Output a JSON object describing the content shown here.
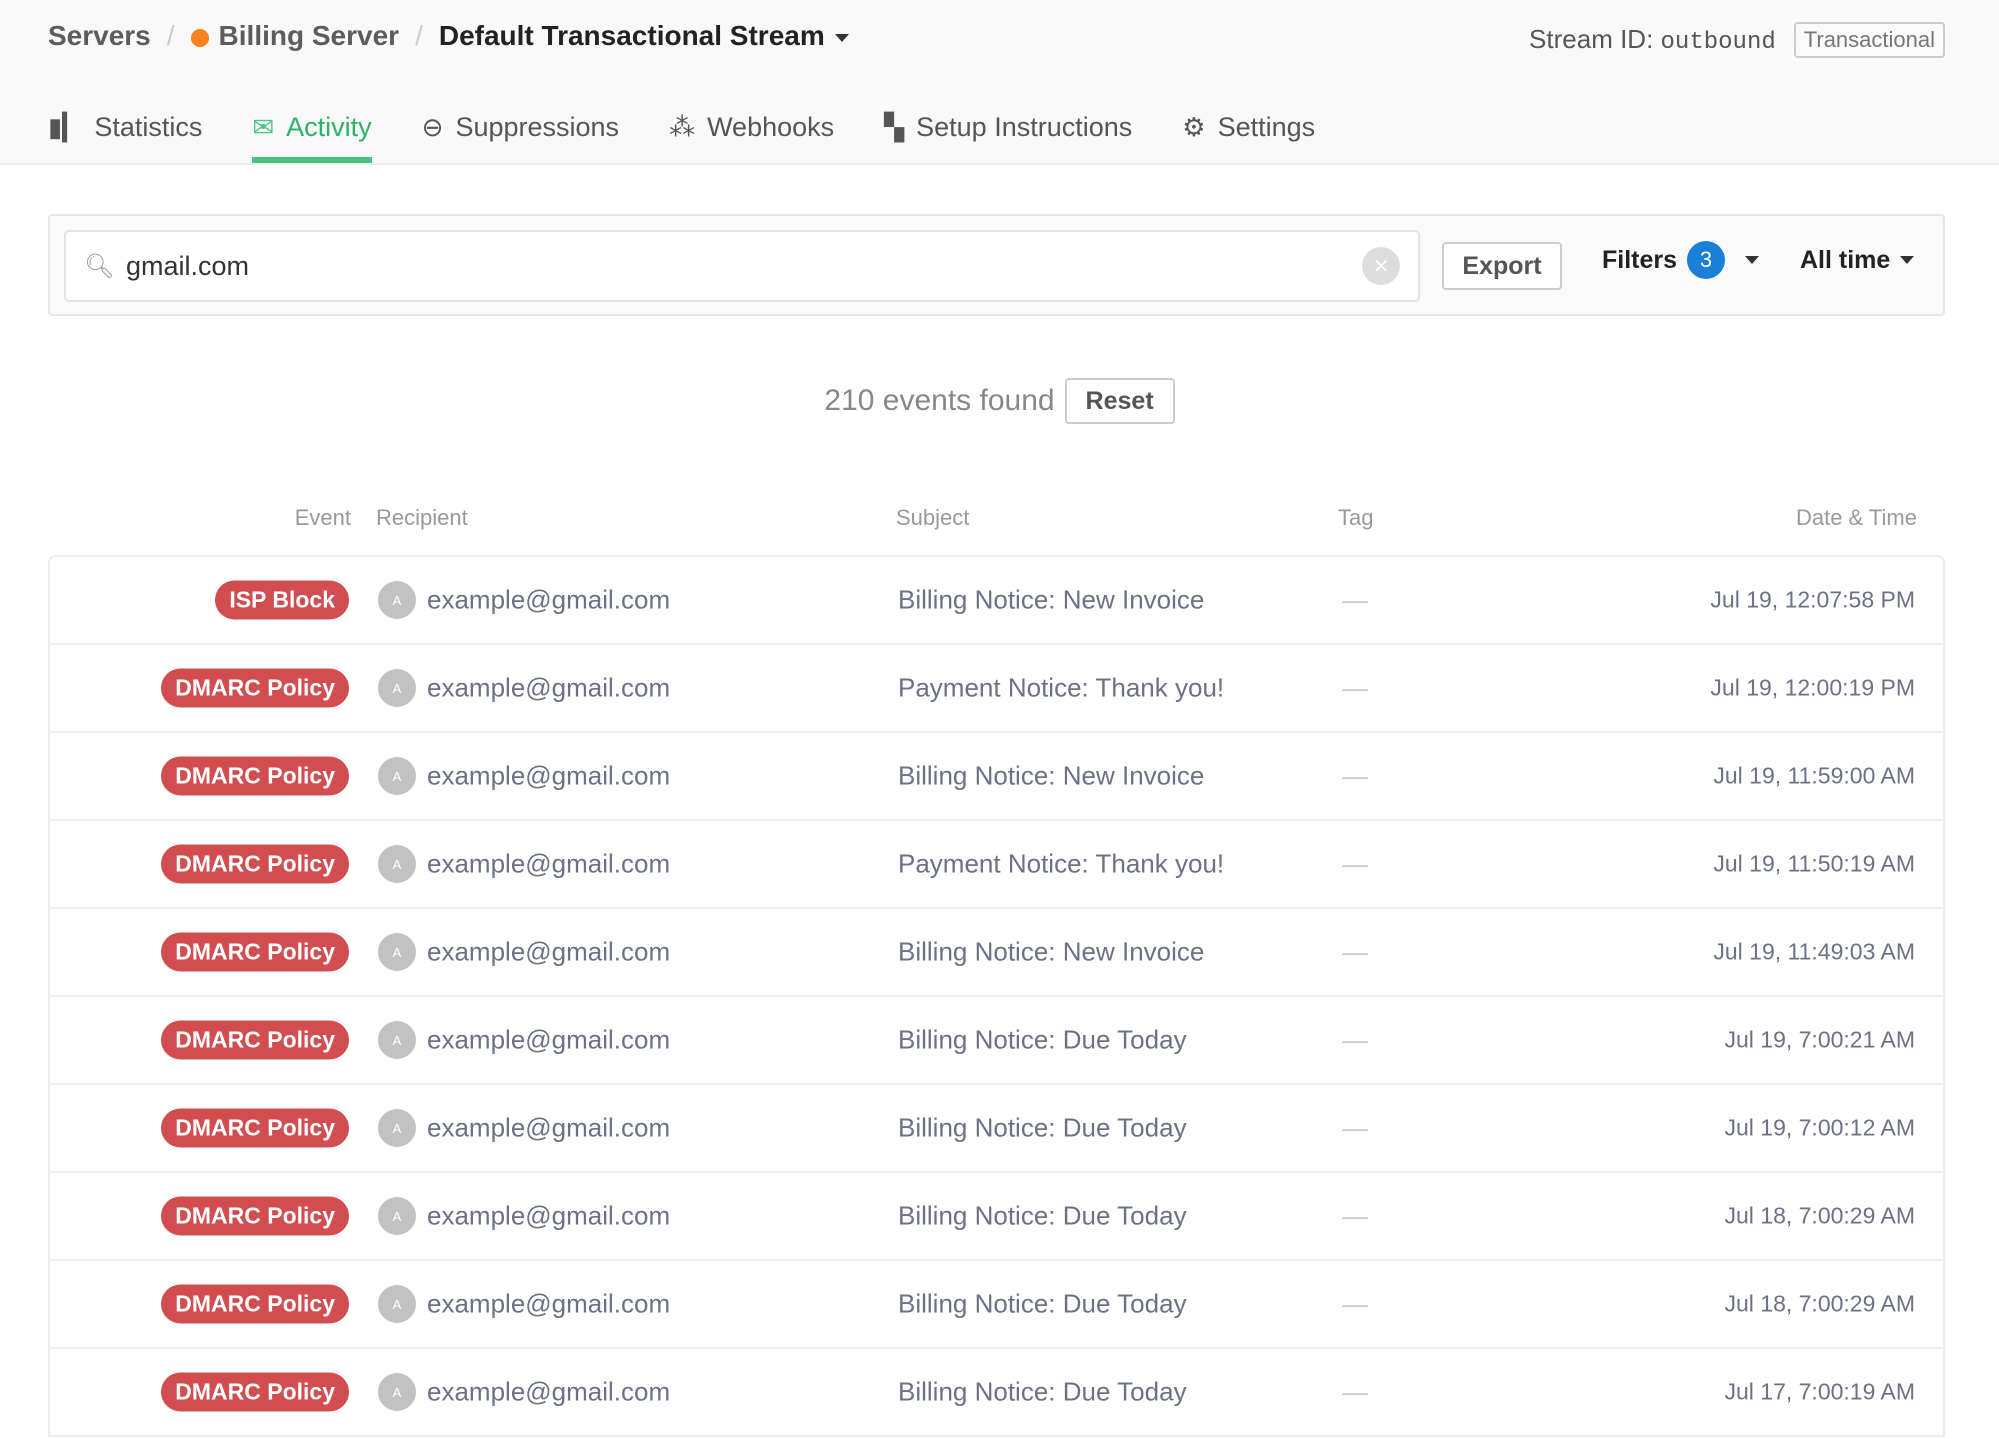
{
  "breadcrumb": {
    "servers": "Servers",
    "server": "Billing Server",
    "stream": "Default Transactional Stream",
    "server_color": "#f7831f"
  },
  "stream_id": {
    "label": "Stream ID:",
    "value": "outbound",
    "type": "Transactional"
  },
  "tabs": [
    {
      "label": "Statistics",
      "icon": "bar-chart-icon"
    },
    {
      "label": "Activity",
      "icon": "envelope-icon"
    },
    {
      "label": "Suppressions",
      "icon": "minus-circle-icon"
    },
    {
      "label": "Webhooks",
      "icon": "webhook-icon"
    },
    {
      "label": "Setup Instructions",
      "icon": "map-icon"
    },
    {
      "label": "Settings",
      "icon": "gear-icon"
    }
  ],
  "search": {
    "value": "gmail.com"
  },
  "toolbar": {
    "export": "Export",
    "filters": "Filters",
    "filter_count": "3",
    "time": "All time"
  },
  "results": {
    "found": "210 events found",
    "reset": "Reset"
  },
  "columns": {
    "event": "Event",
    "recipient": "Recipient",
    "subject": "Subject",
    "tag": "Tag",
    "date": "Date & Time"
  },
  "rows": [
    {
      "event": "ISP Block",
      "avatar": "A",
      "recipient": "example@gmail.com",
      "subject": "Billing Notice: New Invoice",
      "tag": "—",
      "date": "Jul 19, 12:07:58 PM"
    },
    {
      "event": "DMARC Policy",
      "avatar": "A",
      "recipient": "example@gmail.com",
      "subject": "Payment Notice: Thank you!",
      "tag": "—",
      "date": "Jul 19, 12:00:19 PM"
    },
    {
      "event": "DMARC Policy",
      "avatar": "A",
      "recipient": "example@gmail.com",
      "subject": "Billing Notice: New Invoice",
      "tag": "—",
      "date": "Jul 19, 11:59:00 AM"
    },
    {
      "event": "DMARC Policy",
      "avatar": "A",
      "recipient": "example@gmail.com",
      "subject": "Payment Notice: Thank you!",
      "tag": "—",
      "date": "Jul 19, 11:50:19 AM"
    },
    {
      "event": "DMARC Policy",
      "avatar": "A",
      "recipient": "example@gmail.com",
      "subject": "Billing Notice: New Invoice",
      "tag": "—",
      "date": "Jul 19, 11:49:03 AM"
    },
    {
      "event": "DMARC Policy",
      "avatar": "A",
      "recipient": "example@gmail.com",
      "subject": "Billing Notice: Due Today",
      "tag": "—",
      "date": "Jul 19, 7:00:21 AM"
    },
    {
      "event": "DMARC Policy",
      "avatar": "A",
      "recipient": "example@gmail.com",
      "subject": "Billing Notice: Due Today",
      "tag": "—",
      "date": "Jul 19, 7:00:12 AM"
    },
    {
      "event": "DMARC Policy",
      "avatar": "A",
      "recipient": "example@gmail.com",
      "subject": "Billing Notice: Due Today",
      "tag": "—",
      "date": "Jul 18, 7:00:29 AM"
    },
    {
      "event": "DMARC Policy",
      "avatar": "A",
      "recipient": "example@gmail.com",
      "subject": "Billing Notice: Due Today",
      "tag": "—",
      "date": "Jul 18, 7:00:29 AM"
    },
    {
      "event": "DMARC Policy",
      "avatar": "A",
      "recipient": "example@gmail.com",
      "subject": "Billing Notice: Due Today",
      "tag": "—",
      "date": "Jul 17, 7:00:19 AM"
    }
  ]
}
